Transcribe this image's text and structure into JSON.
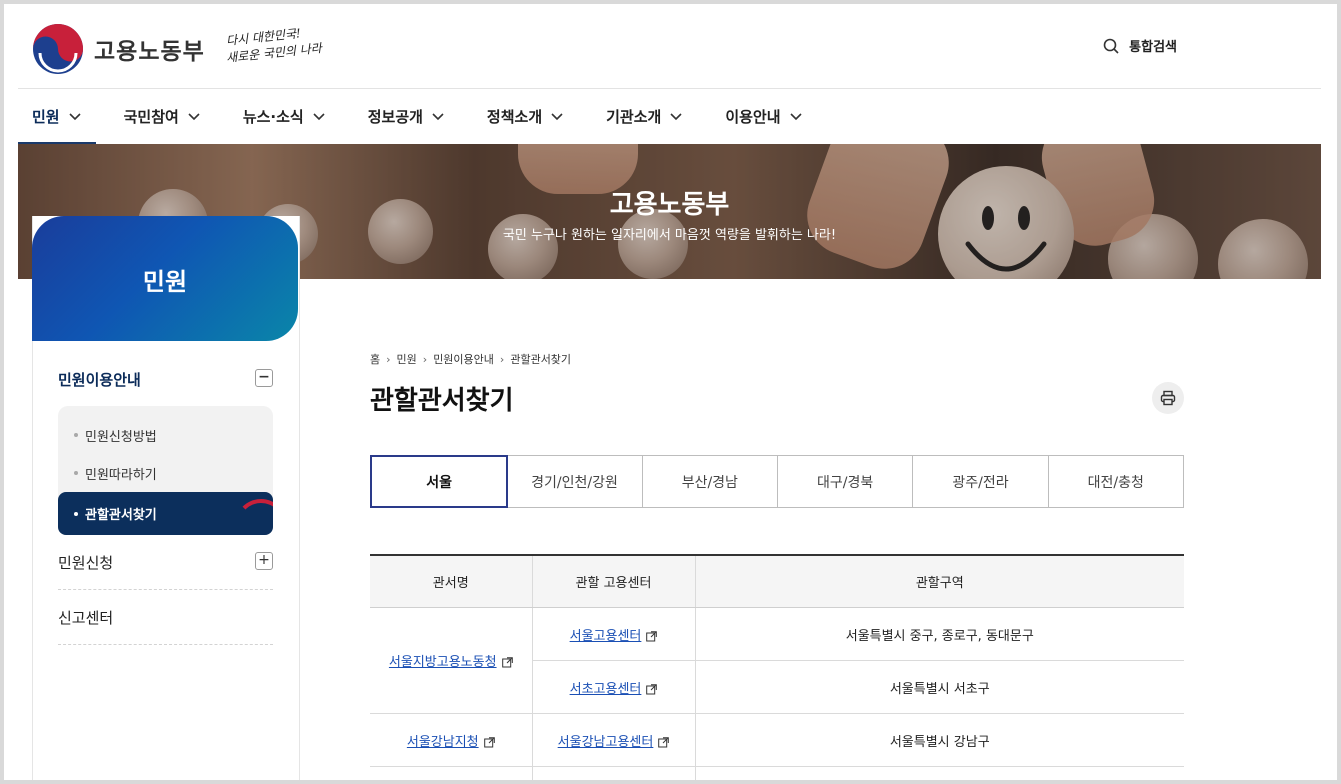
{
  "header": {
    "org_name": "고용노동부",
    "slogan_line1": "다시 대한민국!",
    "slogan_line2": "새로운 국민의 나라",
    "search_label": "통합검색",
    "logo_colors": {
      "red": "#c8203a",
      "blue": "#1d3f8e"
    }
  },
  "gnb": {
    "items": [
      {
        "label": "민원",
        "active": true
      },
      {
        "label": "국민참여"
      },
      {
        "label": "뉴스·소식"
      },
      {
        "label": "정보공개"
      },
      {
        "label": "정책소개"
      },
      {
        "label": "기관소개"
      },
      {
        "label": "이용안내"
      }
    ]
  },
  "banner": {
    "title": "고용노동부",
    "subtitle": "국민 누구나 원하는 일자리에서 마음껏 역량을 발휘하는 나라!"
  },
  "sidebar": {
    "title": "민원",
    "sections": [
      {
        "label": "민원이용안내",
        "toggle": "−",
        "expanded": true,
        "items": [
          {
            "label": "민원신청방법"
          },
          {
            "label": "민원따라하기"
          },
          {
            "label": "관할관서찾기",
            "active": true
          }
        ]
      },
      {
        "label": "민원신청",
        "toggle": "+"
      },
      {
        "label": "신고센터"
      }
    ]
  },
  "breadcrumb": [
    "홈",
    "민원",
    "민원이용안내",
    "관할관서찾기"
  ],
  "page_title": "관할관서찾기",
  "region_tabs": [
    {
      "label": "서울",
      "active": true
    },
    {
      "label": "경기/인천/강원"
    },
    {
      "label": "부산/경남"
    },
    {
      "label": "대구/경북"
    },
    {
      "label": "광주/전라"
    },
    {
      "label": "대전/충청"
    }
  ],
  "table": {
    "headers": [
      "관서명",
      "관할 고용센터",
      "관할구역"
    ],
    "rows": [
      {
        "office": "서울지방고용노동청",
        "center": "서울고용센터",
        "area": "서울특별시 중구, 종로구, 동대문구"
      },
      {
        "center": "서초고용센터",
        "area": "서울특별시 서초구"
      },
      {
        "office": "서울강남지청",
        "center": "서울강남고용센터",
        "area": "서울특별시 강남구"
      }
    ]
  }
}
